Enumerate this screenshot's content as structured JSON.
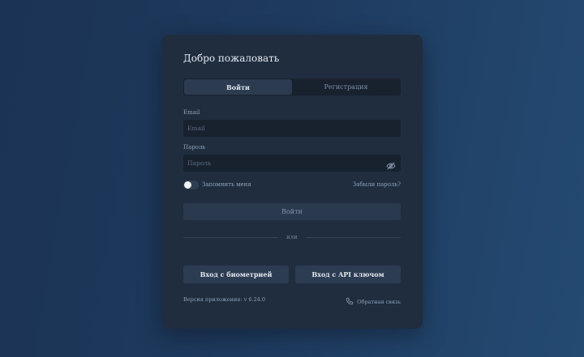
{
  "card": {
    "title": "Добро пожаловать",
    "tabs": [
      {
        "label": "Войти",
        "active": true
      },
      {
        "label": "Регистрация",
        "active": false
      }
    ],
    "email": {
      "label": "Email",
      "placeholder": "Email",
      "value": ""
    },
    "password": {
      "label": "Пароль",
      "placeholder": "Пароль",
      "value": "",
      "toggle_icon": "eye-off-icon"
    },
    "remember_me": {
      "label": "Запомнить меня",
      "checked": false
    },
    "forgot_password": "Забыли пароль?",
    "login_button": "Войти",
    "divider_text": "или",
    "alt_buttons": {
      "biometric": "Вход с биометрией",
      "api_key": "Вход с API ключом"
    },
    "footer": {
      "version": "Версия приложения: v 6.24.0",
      "feedback": "Обратная связь",
      "feedback_icon": "phone-icon"
    }
  }
}
